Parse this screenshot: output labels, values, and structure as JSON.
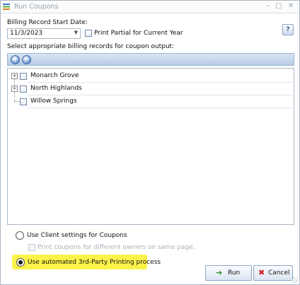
{
  "window": {
    "title": "Run Coupons",
    "minimize_glyph": "–",
    "maximize_glyph": "□",
    "close_glyph": "✕"
  },
  "form": {
    "start_date_label": "Billing Record Start Date:",
    "start_date_value": "11/3/2023",
    "print_partial_label": "Print Partial for Current Year",
    "print_partial_checked": false,
    "help_label": "?",
    "select_records_label": "Select appropriate billing records for coupon output:"
  },
  "toolbar": {
    "expand_all_icon": "expand-all-icon",
    "collapse_all_icon": "collapse-all-icon",
    "expand_glyph": "+",
    "collapse_glyph": "−"
  },
  "tree": {
    "items": [
      {
        "label": "Monarch Grove",
        "expandable": true,
        "checked": false
      },
      {
        "label": "North Highlands",
        "expandable": true,
        "checked": false
      },
      {
        "label": "Willow Springs",
        "expandable": false,
        "checked": false
      }
    ]
  },
  "options": {
    "client_settings_label": "Use Client settings for Coupons",
    "client_settings_selected": false,
    "different_owners_label": "Print coupons for different owners on same page.",
    "different_owners_enabled": false,
    "third_party_label": "Use automated 3rd-Party Printing process",
    "third_party_selected": true,
    "highlight_color": "#fbf34a"
  },
  "buttons": {
    "run_label": "Run",
    "cancel_label": "Cancel"
  },
  "colors": {
    "toolbar_blue": "#b7cbe4",
    "run_icon_green": "#2e8b2e",
    "cancel_icon_red": "#d02020"
  }
}
